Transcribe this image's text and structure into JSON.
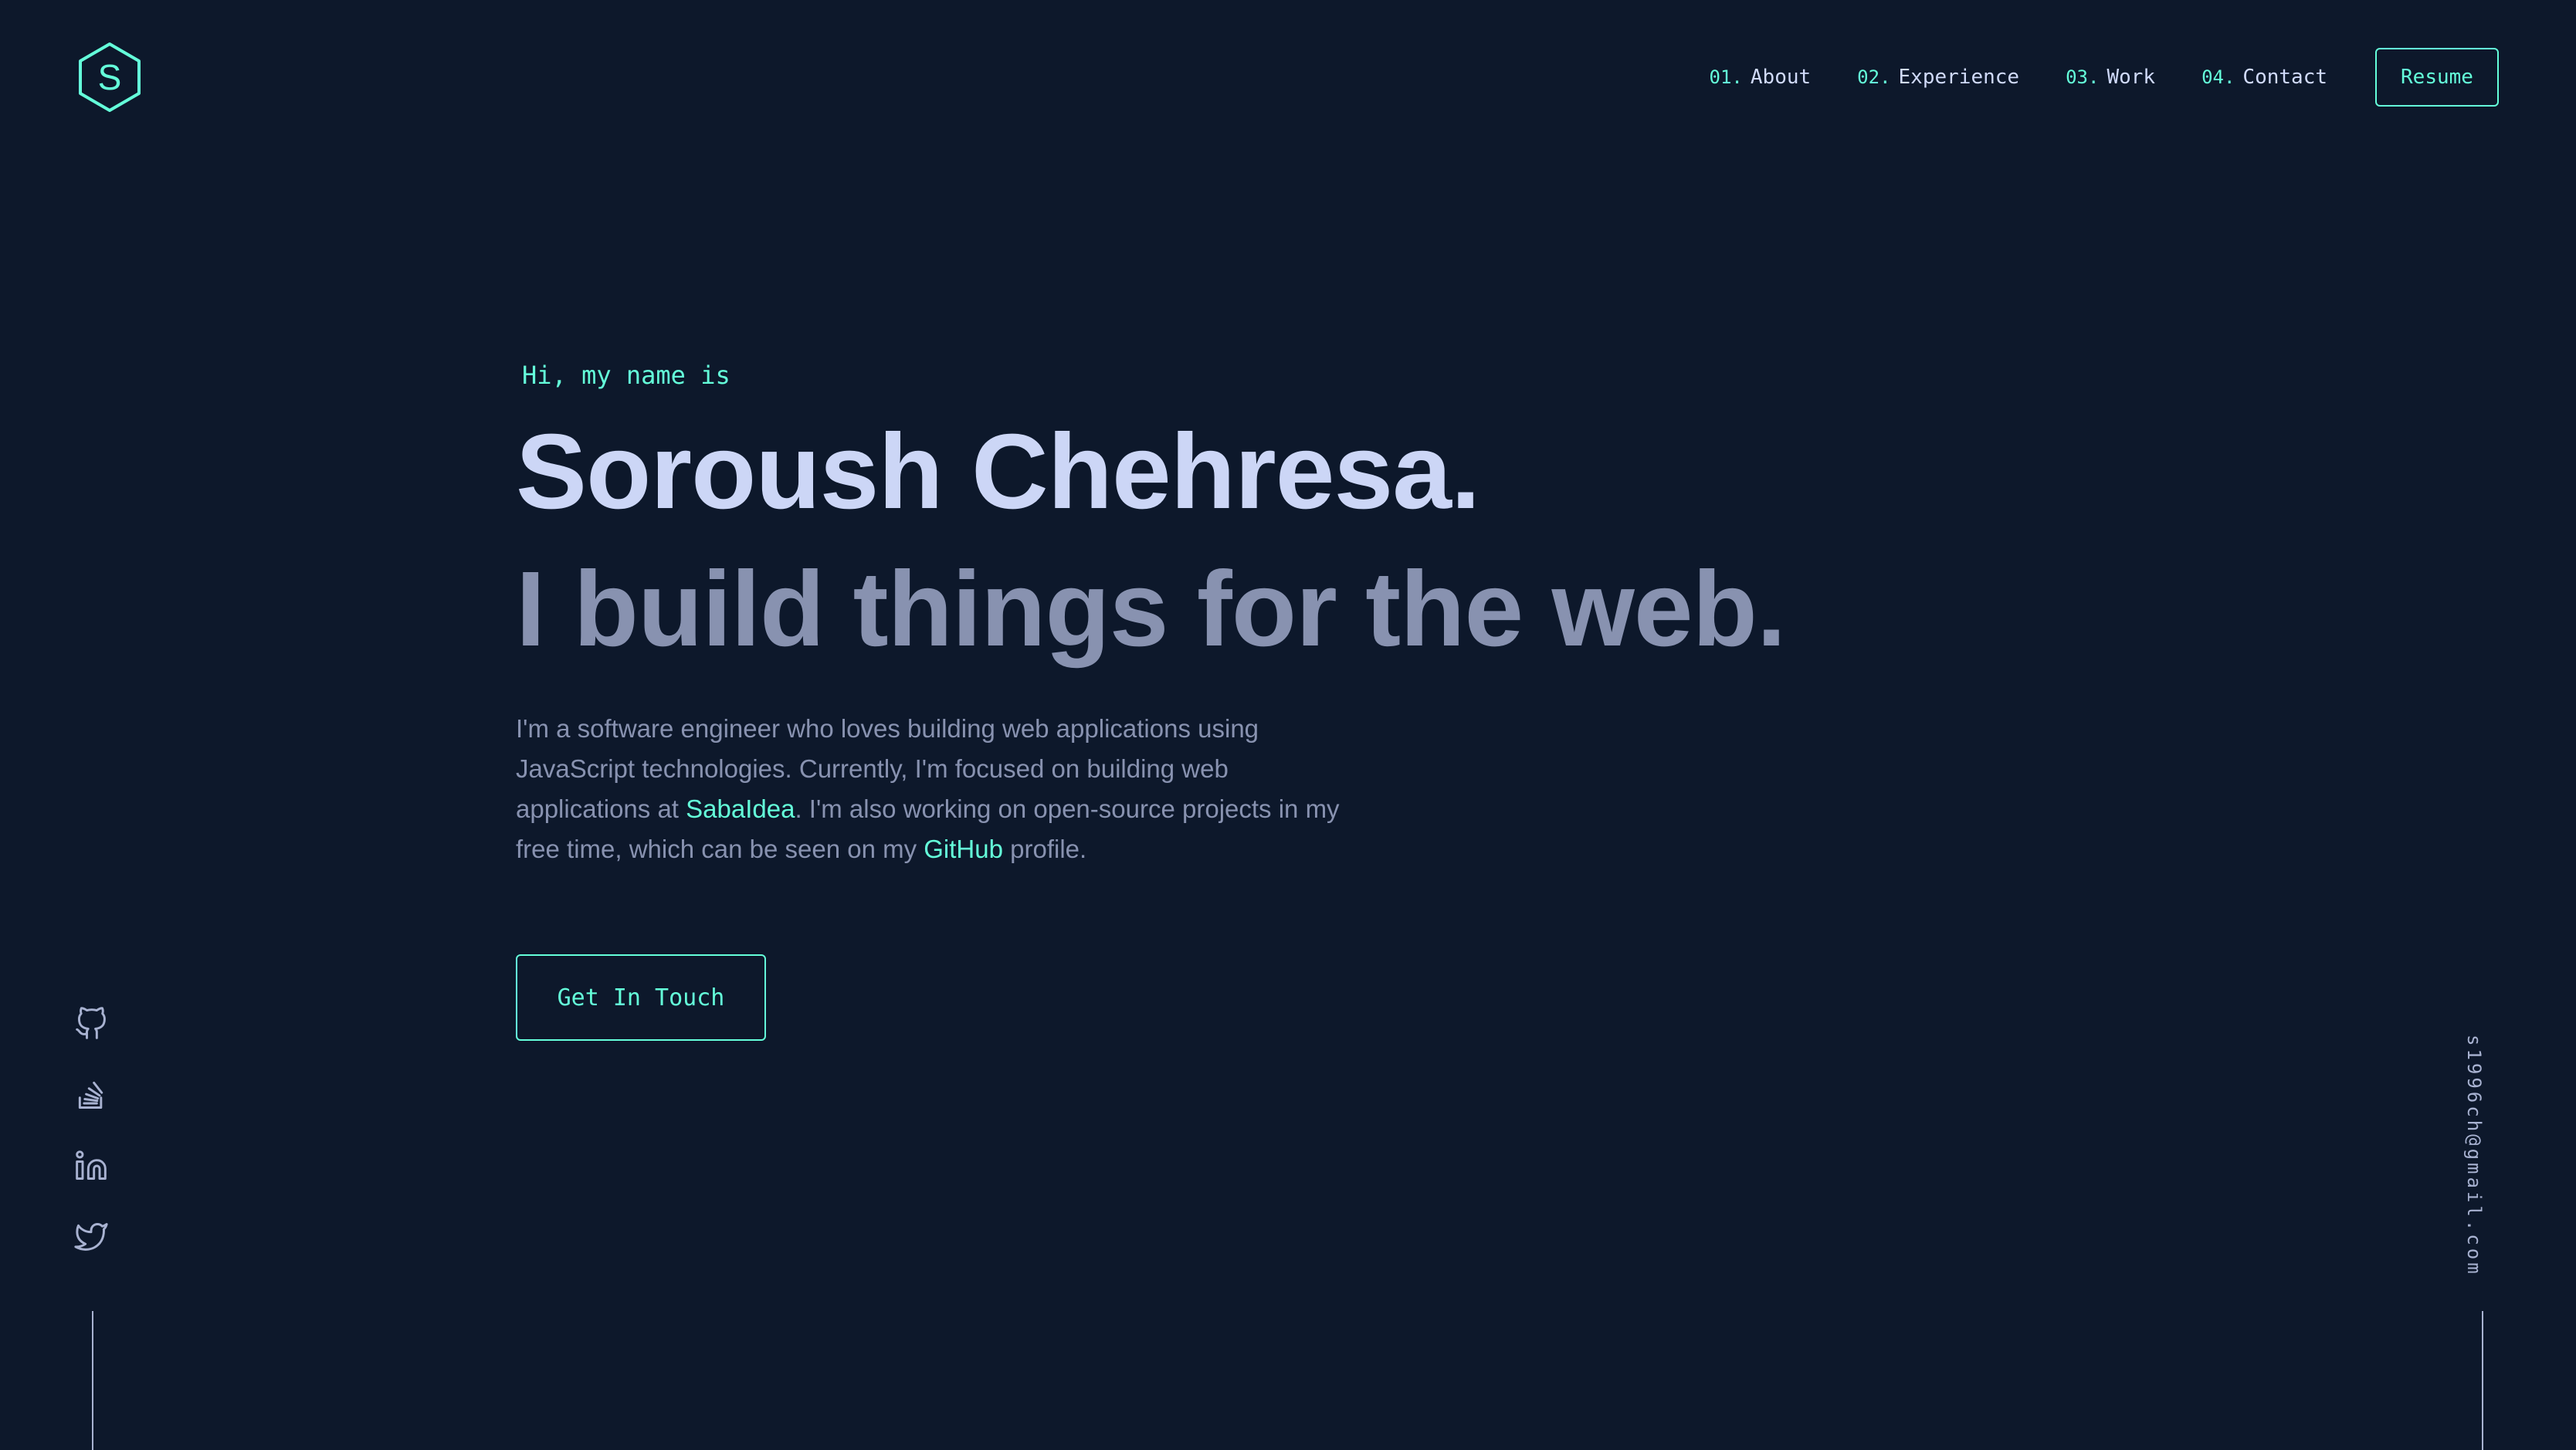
{
  "logo": {
    "letter": "S",
    "icon": "hexagon-logo-icon"
  },
  "nav": {
    "items": [
      {
        "num": "01.",
        "label": "About"
      },
      {
        "num": "02.",
        "label": "Experience"
      },
      {
        "num": "03.",
        "label": "Work"
      },
      {
        "num": "04.",
        "label": "Contact"
      }
    ],
    "resume_label": "Resume"
  },
  "hero": {
    "greeting": "Hi, my name is",
    "name": "Soroush Chehresa.",
    "tagline": "I build things for the web.",
    "bio": {
      "part1": "I'm a software engineer who loves building web applications using JavaScript technologies. Currently, I'm focused on building web applications at ",
      "link1": "SabaIdea",
      "part2": ". I'm also working on open-source projects in my free time, which can be seen on my ",
      "link2": "GitHub",
      "part3": " profile."
    },
    "cta_label": "Get In Touch"
  },
  "social": [
    {
      "icon": "github-icon"
    },
    {
      "icon": "stackoverflow-icon"
    },
    {
      "icon": "linkedin-icon"
    },
    {
      "icon": "twitter-icon"
    }
  ],
  "email": "s1996ch@gmail.com",
  "colors": {
    "background": "#0d182b",
    "accent": "#64ffda",
    "heading": "#ccd6f6",
    "muted": "#8892b0",
    "nav_text": "#d0dafa"
  }
}
